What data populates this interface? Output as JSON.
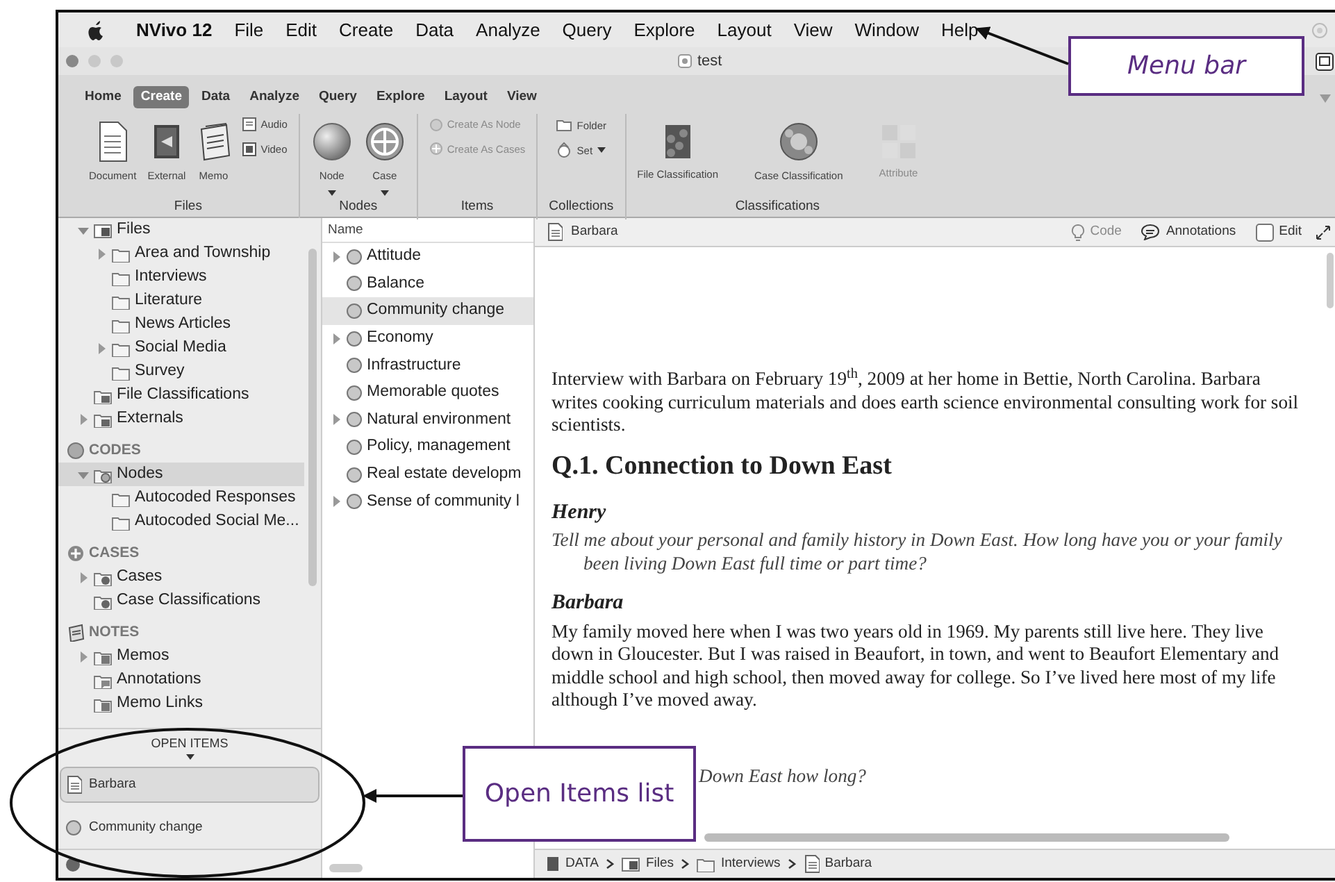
{
  "menu_bar": {
    "app": "NVivo 12",
    "items": [
      "File",
      "Edit",
      "Create",
      "Data",
      "Analyze",
      "Query",
      "Explore",
      "Layout",
      "View",
      "Window",
      "Help"
    ]
  },
  "window": {
    "title": "test"
  },
  "ribbon": {
    "tabs": [
      {
        "label": "Home",
        "selected": false
      },
      {
        "label": "Create",
        "selected": true
      },
      {
        "label": "Data",
        "selected": false
      },
      {
        "label": "Analyze",
        "selected": false
      },
      {
        "label": "Query",
        "selected": false
      },
      {
        "label": "Explore",
        "selected": false
      },
      {
        "label": "Layout",
        "selected": false
      },
      {
        "label": "View",
        "selected": false
      }
    ],
    "groups": [
      {
        "label": "Files",
        "buttons": [
          {
            "label": "Document",
            "kind": "document",
            "disabled": false
          },
          {
            "label": "External",
            "kind": "external",
            "disabled": false
          },
          {
            "label": "Memo",
            "kind": "memo",
            "disabled": false
          },
          {
            "label": "Audio",
            "kind": "audio",
            "disabled": false
          },
          {
            "label": "Video",
            "kind": "video",
            "disabled": false
          }
        ]
      },
      {
        "label": "Nodes",
        "buttons": [
          {
            "label": "Node",
            "kind": "node",
            "disabled": false
          },
          {
            "label": "Case",
            "kind": "case",
            "disabled": false
          }
        ]
      },
      {
        "label": "Items",
        "buttons": [
          {
            "label": "Create As Node",
            "kind": "create-node",
            "disabled": true
          },
          {
            "label": "Create As Cases",
            "kind": "create-cases",
            "disabled": true
          }
        ]
      },
      {
        "label": "Collections",
        "buttons": [
          {
            "label": "Folder",
            "kind": "folder",
            "disabled": false
          },
          {
            "label": "Set",
            "kind": "set",
            "disabled": false
          }
        ]
      },
      {
        "label": "Classifications",
        "buttons": [
          {
            "label": "File Classification",
            "kind": "file-classification",
            "disabled": false
          },
          {
            "label": "Case Classification",
            "kind": "case-classification",
            "disabled": false
          },
          {
            "label": "Attribute",
            "kind": "attribute",
            "disabled": true
          }
        ]
      }
    ]
  },
  "navigation": [
    {
      "label": "Files",
      "kind": "files",
      "expanded": true,
      "selected": false,
      "children": [
        {
          "label": "Area and Township",
          "kind": "folder",
          "expanded": false,
          "selected": false
        },
        {
          "label": "Interviews",
          "kind": "folder",
          "selected": false
        },
        {
          "label": "Literature",
          "kind": "folder",
          "selected": false
        },
        {
          "label": "News Articles",
          "kind": "folder",
          "selected": false
        },
        {
          "label": "Social Media",
          "kind": "folder",
          "expanded": false,
          "selected": false
        },
        {
          "label": "Survey",
          "kind": "folder",
          "selected": false
        }
      ]
    },
    {
      "label": "File Classifications",
      "kind": "classification",
      "selected": false
    },
    {
      "label": "Externals",
      "kind": "externals",
      "expanded": false,
      "selected": false
    },
    {
      "label": "CODES",
      "kind": "header-node",
      "selected": false
    },
    {
      "label": "Nodes",
      "kind": "nodes",
      "expanded": true,
      "selected": true,
      "children": [
        {
          "label": "Autocoded Responses",
          "kind": "folder",
          "selected": false
        },
        {
          "label": "Autocoded Social Me...",
          "kind": "folder",
          "selected": false
        }
      ]
    },
    {
      "label": "CASES",
      "kind": "header-case",
      "selected": false
    },
    {
      "label": "Cases",
      "kind": "cases",
      "expanded": false,
      "selected": false
    },
    {
      "label": "Case Classifications",
      "kind": "cases",
      "selected": false
    },
    {
      "label": "NOTES",
      "kind": "header-memo",
      "selected": false
    },
    {
      "label": "Memos",
      "kind": "memos",
      "expanded": false,
      "selected": false
    },
    {
      "label": "Annotations",
      "kind": "annotations",
      "selected": false
    },
    {
      "label": "Memo Links",
      "kind": "memos",
      "selected": false
    }
  ],
  "open_items": {
    "title": "OPEN ITEMS",
    "items": [
      {
        "label": "Barbara",
        "kind": "document",
        "selected": true
      },
      {
        "label": "Community change",
        "kind": "node",
        "selected": false
      }
    ]
  },
  "node_list": {
    "column": "Name",
    "rows": [
      {
        "label": "Attitude",
        "expanded": false,
        "selected": false
      },
      {
        "label": "Balance",
        "selected": false
      },
      {
        "label": "Community change",
        "selected": true
      },
      {
        "label": "Economy",
        "expanded": false,
        "selected": false
      },
      {
        "label": "Infrastructure",
        "selected": false
      },
      {
        "label": "Memorable quotes",
        "selected": false
      },
      {
        "label": "Natural environment",
        "expanded": false,
        "selected": false
      },
      {
        "label": "Policy, management",
        "selected": false
      },
      {
        "label": "Real estate developm",
        "selected": false
      },
      {
        "label": "Sense of community l",
        "expanded": false,
        "selected": false
      }
    ]
  },
  "document": {
    "title": "Barbara",
    "tools": [
      {
        "label": "Code",
        "kind": "code",
        "disabled": true
      },
      {
        "label": "Annotations",
        "kind": "annotations",
        "disabled": false
      },
      {
        "label": "Edit",
        "kind": "checkbox",
        "checked": false
      }
    ],
    "blocks": [
      {
        "kind": "paragraph",
        "text": "Interview with Barbara on February 19$^{th}$, 2009 at her home in Bettie, North Carolina. Barbara writes cooking curriculum materials and does earth science environmental consulting work for soil scientists."
      },
      {
        "kind": "heading",
        "text": "Q.1. Connection to Down East"
      },
      {
        "kind": "speaker",
        "text": "Henry"
      },
      {
        "kind": "question",
        "text": "Tell me about your personal and family history in Down East. How long have you or your family been living Down East full time or part time?"
      },
      {
        "kind": "speaker",
        "text": "Barbara"
      },
      {
        "kind": "paragraph",
        "text": "My family moved here when I was two years old in 1969. My parents still live here. They live down in Gloucester. But I was raised in Beaufort, in town, and went to Beaufort Elementary and middle school and high school, then moved away for college. So I’ve lived here most of my life although I’ve moved away."
      },
      {
        "kind": "fragment",
        "text": "Down East how long?"
      }
    ]
  },
  "breadcrumb": [
    {
      "label": "DATA",
      "kind": "data"
    },
    {
      "label": "Files",
      "kind": "files"
    },
    {
      "label": "Interviews",
      "kind": "folder"
    },
    {
      "label": "Barbara",
      "kind": "document"
    }
  ],
  "callouts": [
    {
      "text": "Menu bar",
      "kind": "menu"
    },
    {
      "text": "Open Items list",
      "kind": "open-items"
    }
  ]
}
